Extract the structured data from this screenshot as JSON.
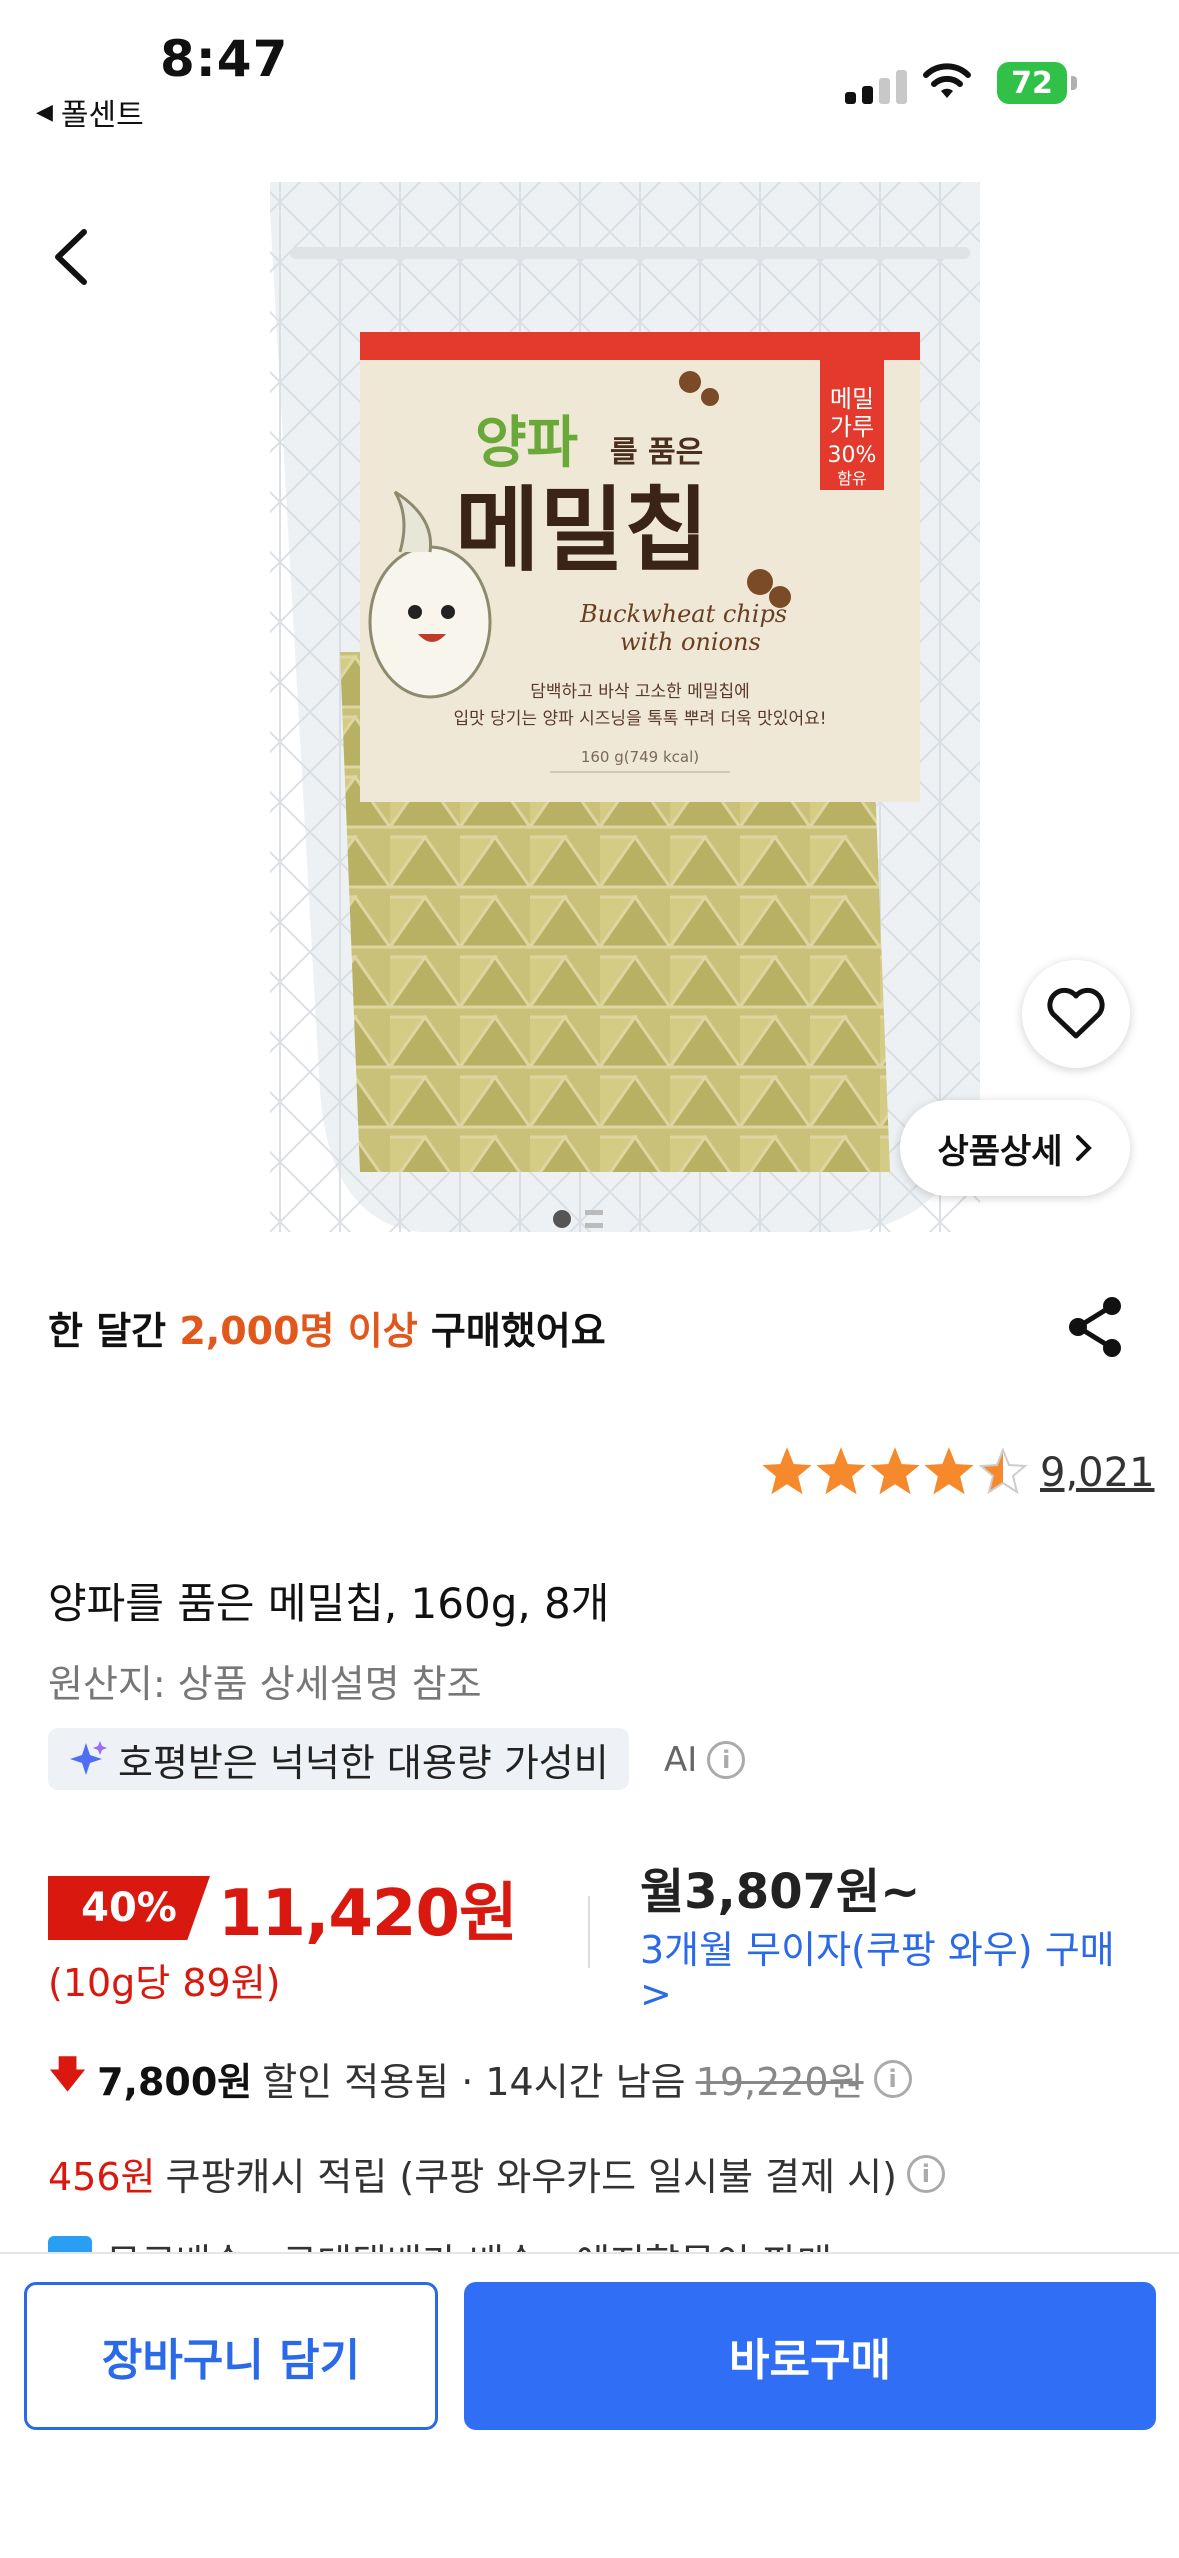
{
  "status_bar": {
    "time": "8:47",
    "back_app": "폴센트",
    "battery": "72"
  },
  "product": {
    "purchase_prefix": "한 달간 ",
    "purchase_count": "2,000명 이상",
    "purchase_suffix": " 구매했어요",
    "rating": 4.5,
    "review_count": "9,021",
    "title": "양파를 품은 메밀칩, 160g, 8개",
    "origin": "원산지: 상품 상세설명 참조",
    "ai_summary": "호평받은 넉넉한 대용량 가성비",
    "ai_label": "AI",
    "detail_button": "상품상세",
    "image_page_count": 2,
    "image_page_current": 1
  },
  "package": {
    "title_part1": "양파",
    "title_part2": "를 품은",
    "title_main": "메밀칩",
    "tag": "메밀\n가루\n30%\n함유",
    "english": "Buckwheat chips with onions",
    "desc1": "담백하고 바삭 고소한 메밀칩에",
    "desc2": "입맛 당기는 양파 시즈닝을 톡톡 뿌려 더욱 맛있어요!",
    "weight": "160 g(749 kcal)"
  },
  "price": {
    "discount": "40%",
    "sale_price": "11,420원",
    "unit_price": "(10g당 89원)",
    "monthly": "월3,807원~",
    "installment": "3개월 무이자(쿠팡 와우) 구매 >",
    "coupon_amount": "7,800원",
    "coupon_text": "할인 적용됨 · 14시간 남음",
    "original_price": "19,220원",
    "cash_amount": "456원",
    "cash_text": "쿠팡캐시 적립 (쿠팡 와우카드 일시불 결제 시)",
    "shipping": "무료배송 · 로데택배가 배송 · 예지향몰이 판매"
  },
  "actions": {
    "cart": "장바구니 담기",
    "buy": "바로구매"
  },
  "colors": {
    "accent_blue": "#2f6ef5",
    "sale_red": "#d9190f",
    "highlight_orange": "#e0581b",
    "star": "#f5892b"
  }
}
